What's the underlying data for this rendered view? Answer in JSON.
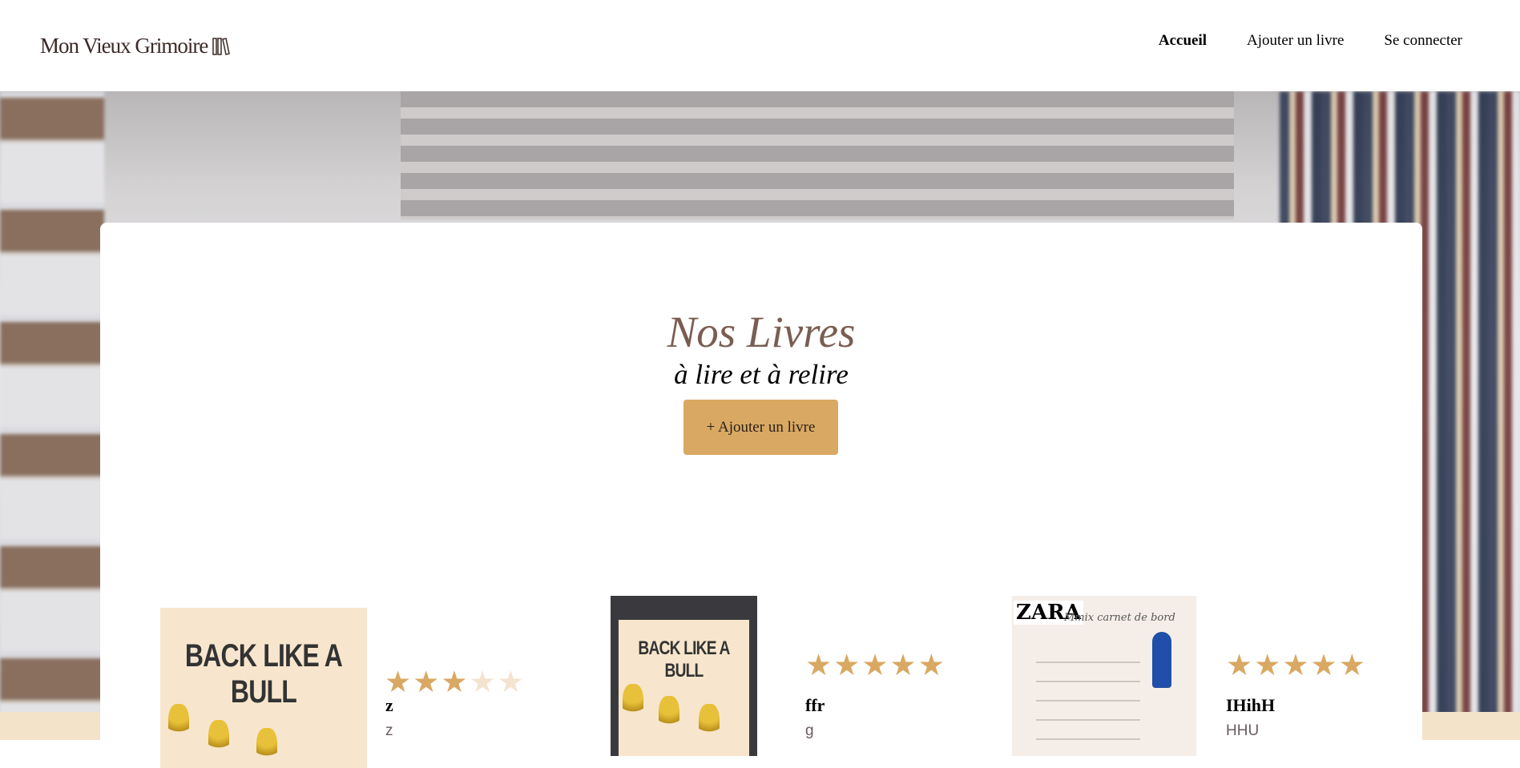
{
  "header": {
    "logo": "Mon Vieux Grimoire",
    "nav": [
      {
        "label": "Accueil",
        "active": true
      },
      {
        "label": "Ajouter un livre"
      },
      {
        "label": "Se connecter"
      }
    ]
  },
  "main": {
    "title": "Nos Livres",
    "subtitle": "à lire et à relire",
    "add_button": "+ Ajouter un livre"
  },
  "books": [
    {
      "title": "z",
      "author": "z",
      "rating": 3,
      "cover_text": "BACK LIKE A BULL"
    },
    {
      "title": "ffr",
      "author": "g",
      "rating": 5,
      "cover_text": "BACK LIKE A BULL"
    },
    {
      "title": "IHihH",
      "author": "HHU",
      "rating": 5,
      "cover_title": "Mmix carnet de bord",
      "cover_brand": "ZARA"
    }
  ],
  "colors": {
    "accent": "#d9a862",
    "title": "#7a5d52"
  }
}
